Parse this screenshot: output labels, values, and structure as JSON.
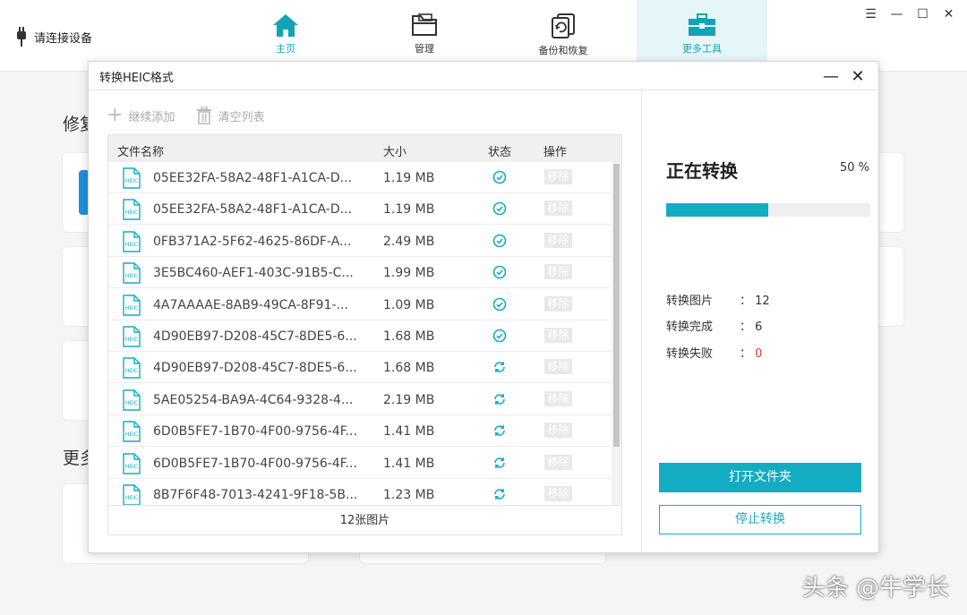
{
  "app": {
    "device_label": "请连接设备",
    "nav": [
      {
        "label": "主页",
        "icon": "home-icon"
      },
      {
        "label": "管理",
        "icon": "folder-icon"
      },
      {
        "label": "备份和恢复",
        "icon": "backup-restore-icon"
      },
      {
        "label": "更多工具",
        "icon": "toolbox-icon"
      }
    ],
    "active_nav": "更多工具",
    "window_controls": [
      "menu-icon",
      "minimize-icon",
      "maximize-icon",
      "close-icon"
    ],
    "bg_heading_1": "修复",
    "bg_heading_2": "更多",
    "accent_color": "#14acc2"
  },
  "dialog": {
    "title": "转换HEIC格式",
    "toolbar": {
      "add_label": "继续添加",
      "clear_label": "清空列表"
    },
    "columns": {
      "name": "文件名称",
      "size": "大小",
      "status": "状态",
      "action": "操作"
    },
    "rows": [
      {
        "name": "05EE32FA-58A2-48F1-A1CA-D...",
        "size": "1.19 MB",
        "status": "done",
        "action": "移除"
      },
      {
        "name": "05EE32FA-58A2-48F1-A1CA-D...",
        "size": "1.19 MB",
        "status": "done",
        "action": "移除"
      },
      {
        "name": "0FB371A2-5F62-4625-86DF-A...",
        "size": "2.49 MB",
        "status": "done",
        "action": "移除"
      },
      {
        "name": "3E5BC460-AEF1-403C-91B5-C...",
        "size": "1.99 MB",
        "status": "done",
        "action": "移除"
      },
      {
        "name": "4A7AAAAE-8AB9-49CA-8F91-...",
        "size": "1.09 MB",
        "status": "done",
        "action": "移除"
      },
      {
        "name": "4D90EB97-D208-45C7-8DE5-6...",
        "size": "1.68 MB",
        "status": "done",
        "action": "移除"
      },
      {
        "name": "4D90EB97-D208-45C7-8DE5-6...",
        "size": "1.68 MB",
        "status": "converting",
        "action": "移除"
      },
      {
        "name": "5AE05254-BA9A-4C64-9328-4...",
        "size": "2.19 MB",
        "status": "converting",
        "action": "移除"
      },
      {
        "name": "6D0B5FE7-1B70-4F00-9756-4F...",
        "size": "1.41 MB",
        "status": "converting",
        "action": "移除"
      },
      {
        "name": "6D0B5FE7-1B70-4F00-9756-4F...",
        "size": "1.41 MB",
        "status": "converting",
        "action": "移除"
      },
      {
        "name": "8B7F6F48-7013-4241-9F18-5B...",
        "size": "1.23 MB",
        "status": "converting",
        "action": "移除"
      }
    ],
    "file_icon_text": "HEIC",
    "footer": "12张图片",
    "progress": {
      "title": "正在转换",
      "percent_text": "50 %",
      "percent": 50,
      "stats": [
        {
          "label": "转换图片",
          "value": "12",
          "color": "#333333"
        },
        {
          "label": "转换完成",
          "value": "6",
          "color": "#333333"
        },
        {
          "label": "转换失败",
          "value": "0",
          "color": "#e53935"
        }
      ]
    },
    "open_folder_label": "打开文件夹",
    "stop_label": "停止转换"
  },
  "watermark": "头条 @牛学长"
}
